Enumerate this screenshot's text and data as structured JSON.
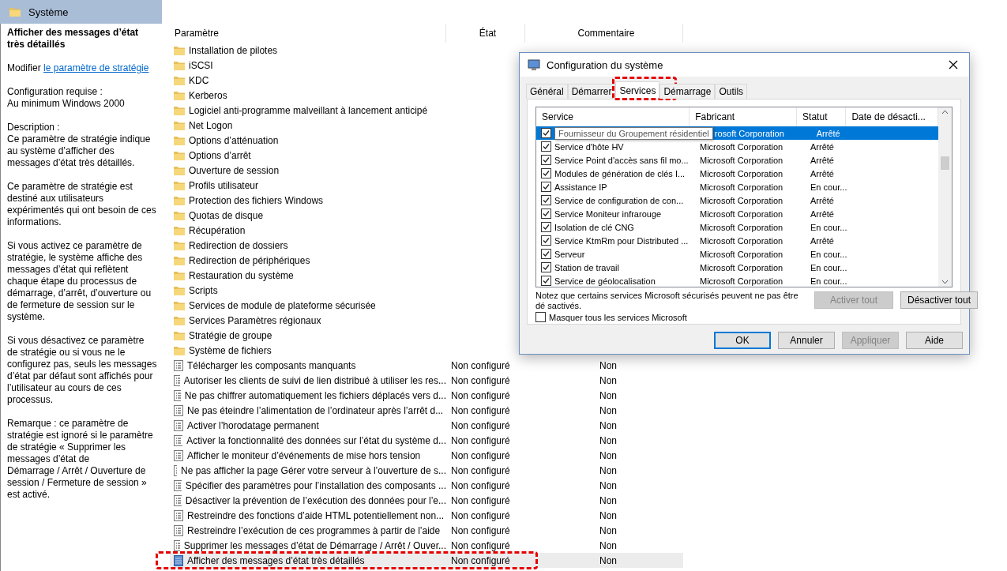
{
  "window": {
    "title": "Système"
  },
  "details": {
    "title": "Afficher des messages d’état très détaillés",
    "modify_prefix": "Modifier",
    "modify_link": "le paramètre de stratégie",
    "paragraphs": [
      "Configuration requise :\nAu minimum Windows 2000",
      "Description :\nCe paramètre de stratégie indique au système d’afficher des messages d’état très détaillés.",
      "Ce paramètre de stratégie est destiné aux utilisateurs expérimentés qui ont besoin de ces informations.",
      "Si vous activez ce paramètre de stratégie, le système affiche des messages d’état qui reflètent chaque étape du processus de démarrage, d’arrêt, d’ouverture ou de fermeture de session sur le système.",
      "Si vous désactivez ce paramètre de stratégie ou si vous ne le configurez pas, seuls les messages d’état par défaut sont affichés pour l’utilisateur au cours de ces processus.",
      "Remarque : ce paramètre de stratégie est ignoré si le paramètre de stratégie « Supprimer les messages d’état de\nDémarrage / Arrêt / Ouverture de session / Fermeture de session » est activé."
    ]
  },
  "table": {
    "columns": [
      "Paramètre",
      "État",
      "Commentaire"
    ],
    "rows": [
      {
        "kind": "folder",
        "name": "Installation de pilotes",
        "selected": false
      },
      {
        "kind": "folder",
        "name": "iSCSI",
        "selected": false
      },
      {
        "kind": "folder",
        "name": "KDC",
        "selected": false
      },
      {
        "kind": "folder",
        "name": "Kerberos",
        "selected": false
      },
      {
        "kind": "folder",
        "name": "Logiciel anti-programme malveillant à lancement anticipé",
        "selected": false
      },
      {
        "kind": "folder",
        "name": "Net Logon",
        "selected": false
      },
      {
        "kind": "folder",
        "name": "Options d’atténuation",
        "selected": false
      },
      {
        "kind": "folder",
        "name": "Options d’arrêt",
        "selected": false
      },
      {
        "kind": "folder",
        "name": "Ouverture de session",
        "selected": false
      },
      {
        "kind": "folder",
        "name": "Profils utilisateur",
        "selected": false
      },
      {
        "kind": "folder",
        "name": "Protection des fichiers Windows",
        "selected": false
      },
      {
        "kind": "folder",
        "name": "Quotas de disque",
        "selected": false
      },
      {
        "kind": "folder",
        "name": "Récupération",
        "selected": false
      },
      {
        "kind": "folder",
        "name": "Redirection de dossiers",
        "selected": false
      },
      {
        "kind": "folder",
        "name": "Redirection de périphériques",
        "selected": false
      },
      {
        "kind": "folder",
        "name": "Restauration du système",
        "selected": false
      },
      {
        "kind": "folder",
        "name": "Scripts",
        "selected": false
      },
      {
        "kind": "folder",
        "name": "Services de module de plateforme sécurisée",
        "selected": false
      },
      {
        "kind": "folder",
        "name": "Services Paramètres régionaux",
        "selected": false
      },
      {
        "kind": "folder",
        "name": "Stratégie de groupe",
        "selected": false
      },
      {
        "kind": "folder",
        "name": "Système de fichiers",
        "selected": false
      },
      {
        "kind": "setting",
        "name": "Télécharger les composants manquants",
        "state": "Non configuré",
        "comment": "Non",
        "selected": false
      },
      {
        "kind": "setting",
        "name": "Autoriser les clients de suivi de lien distribué à utiliser les res...",
        "state": "Non configuré",
        "comment": "Non",
        "selected": false
      },
      {
        "kind": "setting",
        "name": "Ne pas chiffrer automatiquement les fichiers déplacés vers d...",
        "state": "Non configuré",
        "comment": "Non",
        "selected": false
      },
      {
        "kind": "setting",
        "name": "Ne pas éteindre l’alimentation de l’ordinateur après l’arrêt d...",
        "state": "Non configuré",
        "comment": "Non",
        "selected": false
      },
      {
        "kind": "setting",
        "name": "Activer l’horodatage permanent",
        "state": "Non configuré",
        "comment": "Non",
        "selected": false
      },
      {
        "kind": "setting",
        "name": "Activer la fonctionnalité des données sur l’état du système d...",
        "state": "Non configuré",
        "comment": "Non",
        "selected": false
      },
      {
        "kind": "setting",
        "name": "Afficher le moniteur d’événements de mise hors tension",
        "state": "Non configuré",
        "comment": "Non",
        "selected": false
      },
      {
        "kind": "setting",
        "name": "Ne pas afficher la page Gérer votre serveur à l’ouverture de s...",
        "state": "Non configuré",
        "comment": "Non",
        "selected": false
      },
      {
        "kind": "setting",
        "name": "Spécifier des paramètres pour l’installation des composants ...",
        "state": "Non configuré",
        "comment": "Non",
        "selected": false
      },
      {
        "kind": "setting",
        "name": "Désactiver la prévention de l’exécution des données pour l’e...",
        "state": "Non configuré",
        "comment": "Non",
        "selected": false
      },
      {
        "kind": "setting",
        "name": "Restreindre des fonctions d’aide HTML potentiellement non...",
        "state": "Non configuré",
        "comment": "Non",
        "selected": false
      },
      {
        "kind": "setting",
        "name": "Restreindre l’exécution de ces programmes à partir de l’aide",
        "state": "Non configuré",
        "comment": "Non",
        "selected": false
      },
      {
        "kind": "setting",
        "name": "Supprimer les messages d’état de Démarrage / Arrêt / Ouver...",
        "state": "Non configuré",
        "comment": "Non",
        "selected": false
      },
      {
        "kind": "setting",
        "name": "Afficher des messages d’état très détaillés",
        "state": "Non configuré",
        "comment": "Non",
        "selected": true,
        "annotated": true
      }
    ]
  },
  "dialog": {
    "title": "Configuration du système",
    "tabs": [
      {
        "label": "Général",
        "selected": false
      },
      {
        "label": "Démarrer",
        "selected": false
      },
      {
        "label": "Services",
        "selected": true,
        "annotated": true
      },
      {
        "label": "Démarrage",
        "selected": false
      },
      {
        "label": "Outils",
        "selected": false
      }
    ],
    "columns": [
      "Service",
      "Fabricant",
      "Statut",
      "Date de désacti..."
    ],
    "rows": [
      {
        "tooltip": "Fournisseur du Groupement résidentiel",
        "manufacturer": "rosoft Corporation",
        "status": "Arrêté",
        "checked": true,
        "selected": true
      },
      {
        "service": "Service d'hôte HV",
        "manufacturer": "Microsoft Corporation",
        "status": "Arrêté",
        "checked": true,
        "selected": false
      },
      {
        "service": "Service Point d'accès sans fil mo...",
        "manufacturer": "Microsoft Corporation",
        "status": "Arrêté",
        "checked": true,
        "selected": false
      },
      {
        "service": "Modules de génération de clés I...",
        "manufacturer": "Microsoft Corporation",
        "status": "Arrêté",
        "checked": true,
        "selected": false
      },
      {
        "service": "Assistance IP",
        "manufacturer": "Microsoft Corporation",
        "status": "En cour...",
        "checked": true,
        "selected": false
      },
      {
        "service": "Service de configuration de con...",
        "manufacturer": "Microsoft Corporation",
        "status": "Arrêté",
        "checked": true,
        "selected": false
      },
      {
        "service": "Service Moniteur infrarouge",
        "manufacturer": "Microsoft Corporation",
        "status": "Arrêté",
        "checked": true,
        "selected": false
      },
      {
        "service": "Isolation de clé CNG",
        "manufacturer": "Microsoft Corporation",
        "status": "En cour...",
        "checked": true,
        "selected": false
      },
      {
        "service": "Service KtmRm pour Distributed ...",
        "manufacturer": "Microsoft Corporation",
        "status": "Arrêté",
        "checked": true,
        "selected": false
      },
      {
        "service": "Serveur",
        "manufacturer": "Microsoft Corporation",
        "status": "En cour...",
        "checked": true,
        "selected": false
      },
      {
        "service": "Station de travail",
        "manufacturer": "Microsoft Corporation",
        "status": "En cour...",
        "checked": true,
        "selected": false
      },
      {
        "service": "Service de géolocalisation",
        "manufacturer": "Microsoft Corporation",
        "status": "En cour...",
        "checked": true,
        "selected": false
      }
    ],
    "note": "Notez que certains services Microsoft sécurisés peuvent ne pas être dé sactivés.",
    "enable_all": {
      "label": "Activer tout",
      "disabled": true
    },
    "disable_all": {
      "label": "Désactiver tout",
      "disabled": false
    },
    "hide_microsoft": {
      "label": "Masquer tous les services Microsoft",
      "checked": false
    },
    "buttons": [
      {
        "label": "OK",
        "default": true,
        "disabled": false
      },
      {
        "label": "Annuler",
        "default": false,
        "disabled": false
      },
      {
        "label": "Appliquer",
        "default": false,
        "disabled": true
      },
      {
        "label": "Aide",
        "default": false,
        "disabled": false
      }
    ]
  }
}
